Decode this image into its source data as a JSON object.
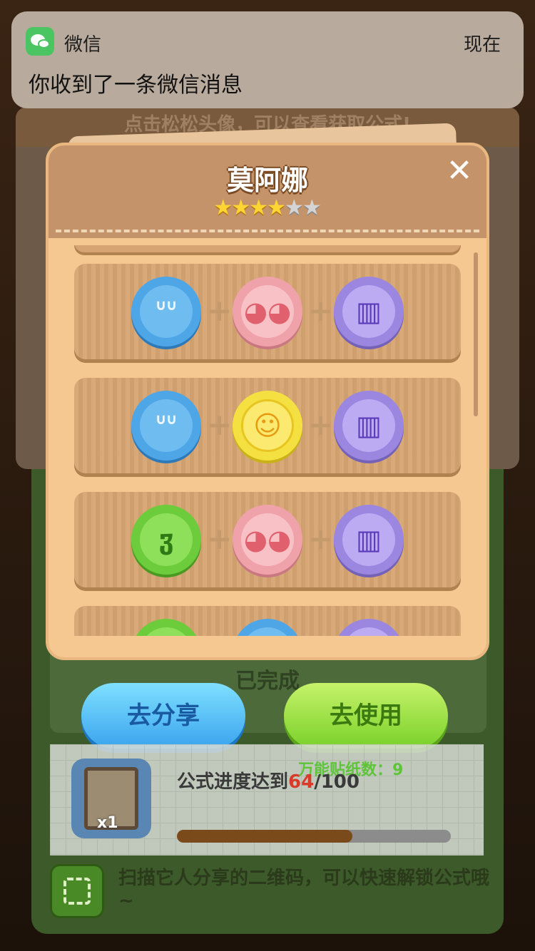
{
  "notification": {
    "app_name": "微信",
    "time": "现在",
    "message": "你收到了一条微信消息",
    "app_icon": "wechat-icon"
  },
  "background": {
    "hint": "点击松松头像，可以查看获取公式!",
    "done_label": "已完成",
    "share_button": "去分享",
    "use_button": "去使用",
    "sticker_count_label": "万能贴纸数：",
    "sticker_count": "9",
    "formula_item_qty": "x1",
    "progress_label": "公式进度达到",
    "progress_current": "64",
    "progress_total": "/100",
    "progress_fraction": 0.64,
    "scan_text": "扫描它人分享的二维码，可以快速解锁公式哦~"
  },
  "popup": {
    "title": "莫阿娜",
    "rating": 4,
    "max_rating": 6,
    "close_icon": "close-icon",
    "recipes": [
      {
        "badges": [
          {
            "color": "blue",
            "icon": "sleepy-eyes-icon",
            "glyph": "ᐡᐡ"
          },
          {
            "color": "pink",
            "icon": "blush-face-icon",
            "glyph": "◕◕"
          },
          {
            "color": "purple",
            "icon": "comb-icon",
            "glyph": "▥"
          }
        ]
      },
      {
        "badges": [
          {
            "color": "blue",
            "icon": "sleepy-eyes-icon",
            "glyph": "ᐡᐡ"
          },
          {
            "color": "yellow",
            "icon": "smile-face-icon",
            "glyph": "☺"
          },
          {
            "color": "purple",
            "icon": "comb-icon",
            "glyph": "▥"
          }
        ]
      },
      {
        "badges": [
          {
            "color": "green",
            "icon": "ear-icon",
            "glyph": "ჳ"
          },
          {
            "color": "pink",
            "icon": "blush-face-icon",
            "glyph": "◕◕"
          },
          {
            "color": "purple",
            "icon": "comb-icon",
            "glyph": "▥"
          }
        ]
      },
      {
        "badges": [
          {
            "color": "green",
            "icon": "ear-icon",
            "glyph": "ჳ"
          },
          {
            "color": "blue",
            "icon": "sleepy-eyes-icon",
            "glyph": "ᐡᐡ"
          },
          {
            "color": "purple",
            "icon": "comb-icon",
            "glyph": "▥"
          }
        ]
      }
    ]
  }
}
